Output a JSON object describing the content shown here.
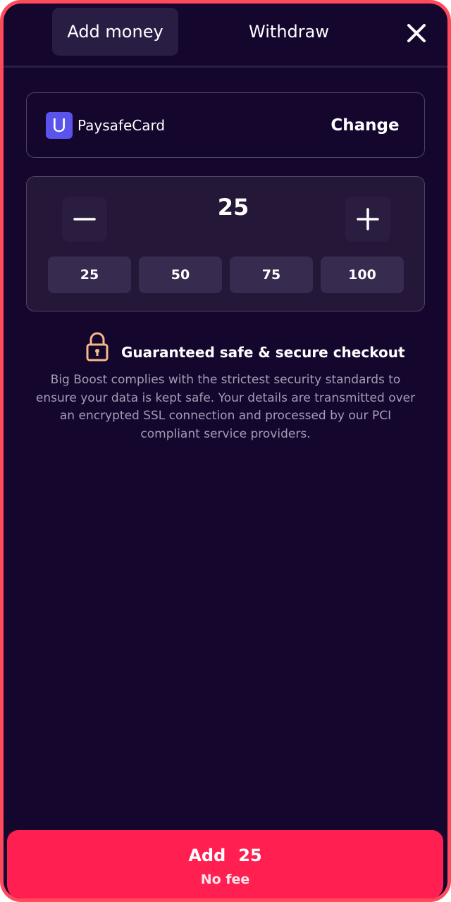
{
  "header": {
    "tabs": [
      {
        "label": "Add money",
        "active": true
      },
      {
        "label": "Withdraw",
        "active": false
      }
    ],
    "close_icon": "close-icon"
  },
  "payment_method": {
    "logo_letter": "U",
    "name": "PaysafeCard",
    "change_label": "Change",
    "logo_color": "#5a54ec"
  },
  "amount": {
    "value": "25",
    "minus_icon": "minus-icon",
    "plus_icon": "plus-icon",
    "presets": [
      "25",
      "50",
      "75",
      "100"
    ]
  },
  "secure": {
    "icon": "lock-icon",
    "title": "Guaranteed safe & secure checkout",
    "description": "Big Boost complies with the strictest security standards to ensure your data is kept safe. Your details are transmitted over an encrypted SSL connection and processed by our PCI compliant service providers."
  },
  "cta": {
    "action": "Add",
    "amount": "25",
    "fee": "No fee"
  },
  "colors": {
    "background": "#14062d",
    "frame_border": "#ff4a5c",
    "accent": "#ff1f50",
    "lock": "#f5b98a"
  }
}
